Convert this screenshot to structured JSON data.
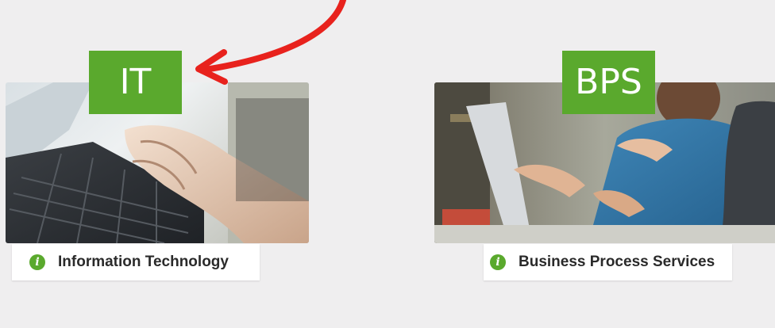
{
  "categories": [
    {
      "tag": "IT",
      "caption": "Information Technology",
      "icon": "info-icon",
      "photo": "hands-typing-on-laptop-keyboard"
    },
    {
      "tag": "BPS",
      "caption": "Business Process Services",
      "icon": "info-icon",
      "photo": "colleagues-working-at-laptop"
    }
  ],
  "colors": {
    "background": "#efeeef",
    "accent_green": "#5aa92d",
    "arrow_red": "#e8221d",
    "caption_background": "#ffffff",
    "caption_text": "#2a2a2a"
  }
}
